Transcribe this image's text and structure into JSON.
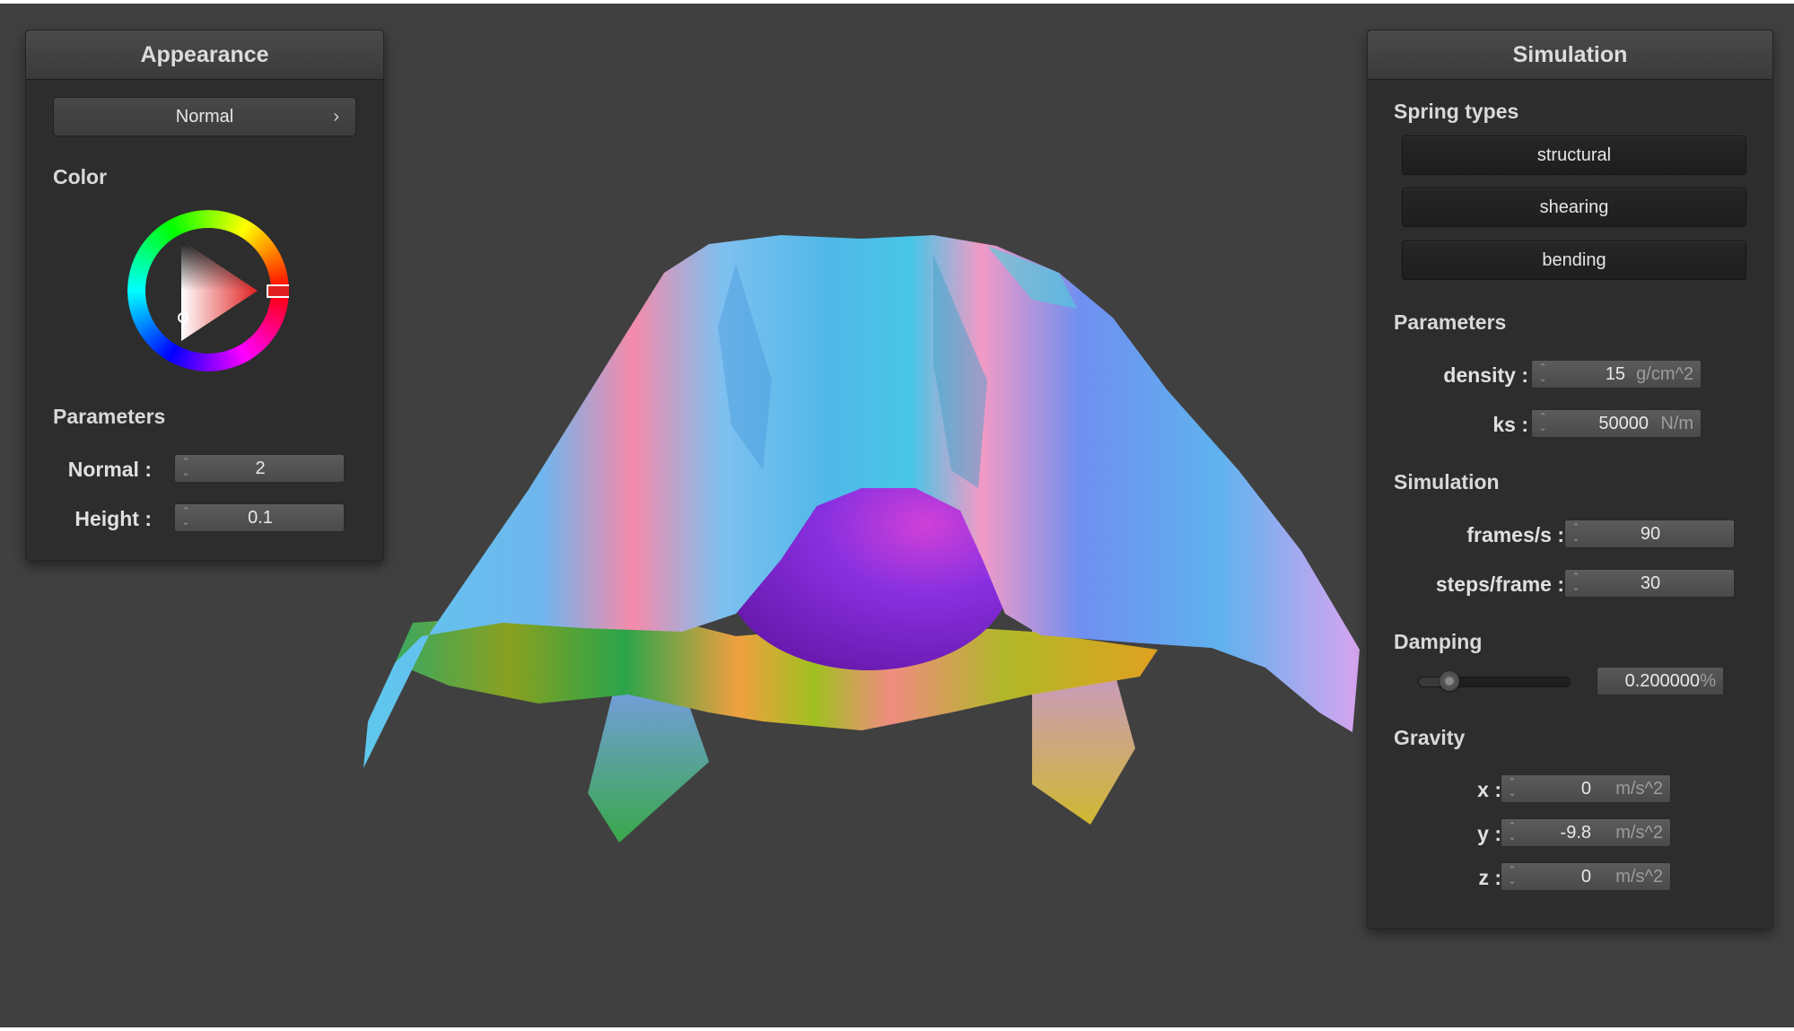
{
  "appearance": {
    "title": "Appearance",
    "shader_select": "Normal",
    "color_label": "Color",
    "color_value": "#e02020",
    "parameters_label": "Parameters",
    "normal": {
      "label": "Normal :",
      "value": "2"
    },
    "height": {
      "label": "Height :",
      "value": "0.1"
    }
  },
  "simulation": {
    "title": "Simulation",
    "spring_types_label": "Spring types",
    "spring_types": [
      "structural",
      "shearing",
      "bending"
    ],
    "parameters_label": "Parameters",
    "density": {
      "label": "density :",
      "value": "15",
      "unit": "g/cm^2"
    },
    "ks": {
      "label": "ks :",
      "value": "50000",
      "unit": "N/m"
    },
    "simulation_label": "Simulation",
    "frames": {
      "label": "frames/s :",
      "value": "90"
    },
    "steps": {
      "label": "steps/frame :",
      "value": "30"
    },
    "damping_label": "Damping",
    "damping": {
      "value": "0.200000",
      "unit": "%",
      "slider_fraction": 0.2
    },
    "gravity_label": "Gravity",
    "gravity": [
      {
        "label": "x :",
        "value": "0",
        "unit": "m/s^2"
      },
      {
        "label": "y :",
        "value": "-9.8",
        "unit": "m/s^2"
      },
      {
        "label": "z :",
        "value": "0",
        "unit": "m/s^2"
      }
    ]
  },
  "icons": {
    "dropdown": "chevron-right-icon",
    "spinner": "spin-arrows-icon"
  }
}
